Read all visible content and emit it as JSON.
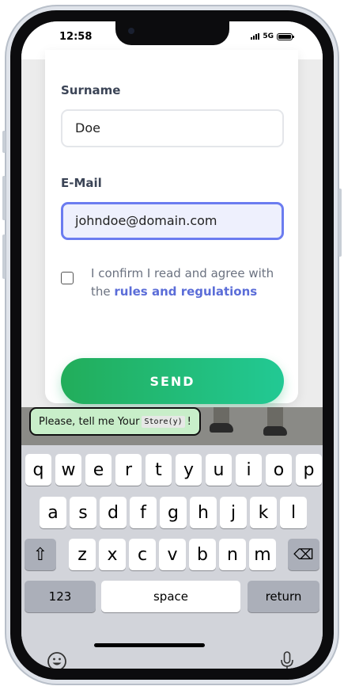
{
  "status": {
    "time": "12:58",
    "network": "5G"
  },
  "form": {
    "surname_label": "Surname",
    "surname_value": "Doe",
    "email_label": "E-Mail",
    "email_value": "johndoe@domain.com",
    "confirm_text": "I confirm I read and agree with the",
    "confirm_link": "rules and regulations",
    "send_label": "SEND"
  },
  "tooltip": {
    "text": "Please, tell me Your",
    "code": "Store(y)",
    "suffix": "!"
  },
  "keyboard": {
    "row1": [
      "q",
      "w",
      "e",
      "r",
      "t",
      "y",
      "u",
      "i",
      "o",
      "p"
    ],
    "row2": [
      "a",
      "s",
      "d",
      "f",
      "g",
      "h",
      "j",
      "k",
      "l"
    ],
    "row3": [
      "z",
      "x",
      "c",
      "v",
      "b",
      "n",
      "m"
    ],
    "shift": "⇧",
    "backspace": "⌫",
    "numbers": "123",
    "space": "space",
    "return": "return"
  },
  "icons": {
    "emoji": "emoji-icon",
    "mic": "microphone-icon"
  }
}
